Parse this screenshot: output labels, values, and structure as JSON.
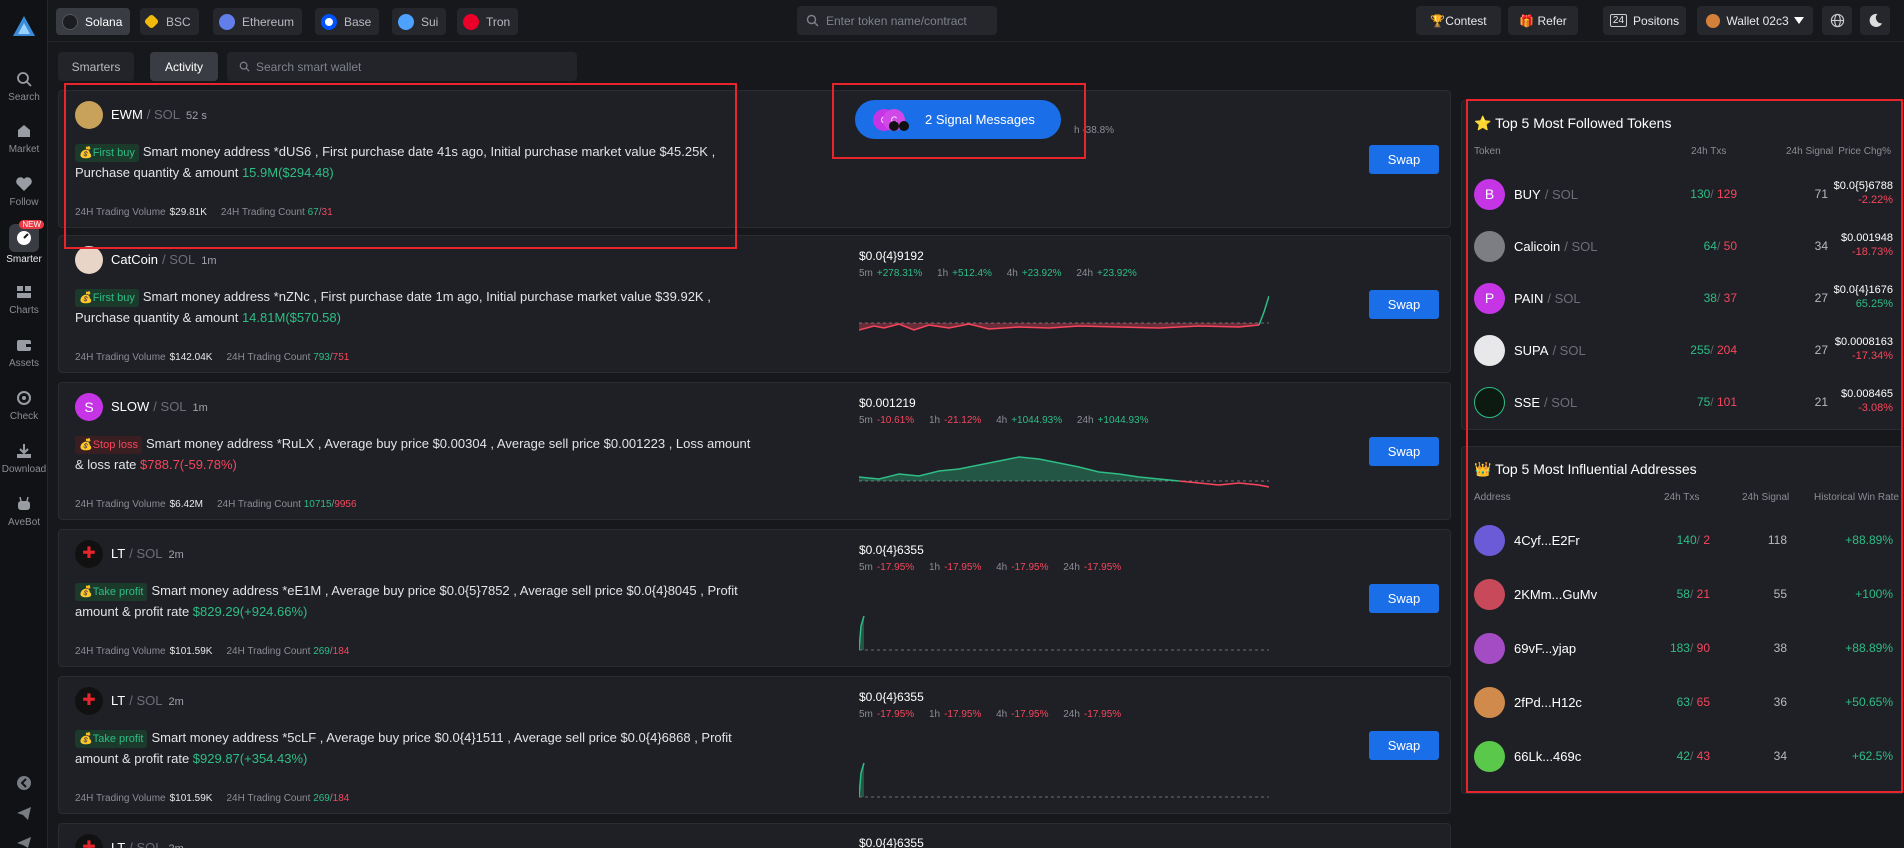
{
  "nav": {
    "items": [
      {
        "label": "Search"
      },
      {
        "label": "Market"
      },
      {
        "label": "Follow"
      },
      {
        "label": "Smarter",
        "badge": "NEW"
      },
      {
        "label": "Charts"
      },
      {
        "label": "Assets"
      },
      {
        "label": "Check"
      },
      {
        "label": "Download"
      },
      {
        "label": "AveBot"
      }
    ]
  },
  "chains": [
    "Solana",
    "BSC",
    "Ethereum",
    "Base",
    "Sui",
    "Tron"
  ],
  "search": {
    "placeholder": "Enter token name/contract"
  },
  "topbar": {
    "contest": "🏆Contest",
    "refer": "🎁 Refer",
    "positions_count": "24",
    "positions_label": "Positons",
    "wallet": "Wallet 02c3"
  },
  "tabs": {
    "smarters": "Smarters",
    "activity": "Activity"
  },
  "wallet_search": {
    "placeholder": "Search smart wallet"
  },
  "signal": {
    "label": "2 Signal Messages",
    "behind_text": "h -38.8%"
  },
  "cards": [
    {
      "symbol": "EWM",
      "chain": "/ SOL",
      "age": "52 s",
      "tag": "First buy",
      "tag_type": "buy",
      "msg": "Smart money address *dUS6 , First purchase date 41s ago, Initial purchase market value $45.25K , Purchase quantity & amount",
      "msg_highlight": "15.9M($294.48)",
      "volume": "$29.81K",
      "count_buy": "67",
      "count_sell": "31",
      "swap": "Swap"
    },
    {
      "symbol": "CatCoin",
      "chain": "/ SOL",
      "age": "1m",
      "tag": "First buy",
      "tag_type": "buy",
      "msg": "Smart money address *nZNc , First purchase date 1m ago, Initial purchase market value $39.92K , Purchase quantity & amount",
      "msg_highlight": "14.81M($570.58)",
      "volume": "$142.04K",
      "count_buy": "793",
      "count_sell": "751",
      "price": "$0.0{4}9192",
      "changes": [
        {
          "p": "5m",
          "v": "+278.31%",
          "up": true
        },
        {
          "p": "1h",
          "v": "+512.4%",
          "up": true
        },
        {
          "p": "4h",
          "v": "+23.92%",
          "up": true
        },
        {
          "p": "24h",
          "v": "+23.92%",
          "up": true
        }
      ],
      "swap": "Swap"
    },
    {
      "symbol": "SLOW",
      "chain": "/ SOL",
      "age": "1m",
      "tag": "Stop loss",
      "tag_type": "loss",
      "msg": "Smart money address *RuLX , Average buy price $0.00304 , Average sell price $0.001223 , Loss amount & loss rate",
      "msg_highlight": "$788.7(-59.78%)",
      "volume": "$6.42M",
      "count_buy": "10715",
      "count_sell": "9956",
      "price": "$0.001219",
      "changes": [
        {
          "p": "5m",
          "v": "-10.61%",
          "up": false
        },
        {
          "p": "1h",
          "v": "-21.12%",
          "up": false
        },
        {
          "p": "4h",
          "v": "+1044.93%",
          "up": true
        },
        {
          "p": "24h",
          "v": "+1044.93%",
          "up": true
        }
      ],
      "swap": "Swap"
    },
    {
      "symbol": "LT",
      "chain": "/ SOL",
      "age": "2m",
      "tag": "Take profit",
      "tag_type": "profit",
      "msg": "Smart money address *eE1M , Average buy price $0.0{5}7852 , Average sell price $0.0{4}8045 , Profit amount & profit rate",
      "msg_highlight": "$829.29(+924.66%)",
      "volume": "$101.59K",
      "count_buy": "269",
      "count_sell": "184",
      "price": "$0.0{4}6355",
      "changes": [
        {
          "p": "5m",
          "v": "-17.95%",
          "up": false
        },
        {
          "p": "1h",
          "v": "-17.95%",
          "up": false
        },
        {
          "p": "4h",
          "v": "-17.95%",
          "up": false
        },
        {
          "p": "24h",
          "v": "-17.95%",
          "up": false
        }
      ],
      "swap": "Swap"
    },
    {
      "symbol": "LT",
      "chain": "/ SOL",
      "age": "2m",
      "tag": "Take profit",
      "tag_type": "profit",
      "msg": "Smart money address *5cLF , Average buy price $0.0{4}1511 , Average sell price $0.0{4}6868 , Profit amount & profit rate",
      "msg_highlight": "$929.87(+354.43%)",
      "volume": "$101.59K",
      "count_buy": "269",
      "count_sell": "184",
      "price": "$0.0{4}6355",
      "changes": [
        {
          "p": "5m",
          "v": "-17.95%",
          "up": false
        },
        {
          "p": "1h",
          "v": "-17.95%",
          "up": false
        },
        {
          "p": "4h",
          "v": "-17.95%",
          "up": false
        },
        {
          "p": "24h",
          "v": "-17.95%",
          "up": false
        }
      ],
      "swap": "Swap"
    },
    {
      "symbol": "LT",
      "chain": "/ SOL",
      "age": "2m",
      "price": "$0.0{4}6355"
    }
  ],
  "labels": {
    "volume": "24H Trading Volume",
    "count": "24H Trading Count"
  },
  "followed": {
    "title": "Top 5 Most Followed Tokens",
    "headers": {
      "token": "Token",
      "txs": "24h Txs",
      "signal": "24h Signal",
      "price": "Price Chg%"
    },
    "rows": [
      {
        "symbol": "BUY",
        "chain": "/ SOL",
        "buys": "130",
        "sells": "129",
        "signal": "71",
        "price": "$0.0{5}6788",
        "chg": "-2.22%",
        "up": false,
        "letter": "B",
        "color": "#c535e6"
      },
      {
        "symbol": "Calicoin",
        "chain": "/ SOL",
        "buys": "64",
        "sells": "50",
        "signal": "34",
        "price": "$0.001948",
        "chg": "-18.73%",
        "up": false,
        "letter": "",
        "color": "#7c7e84"
      },
      {
        "symbol": "PAIN",
        "chain": "/ SOL",
        "buys": "38",
        "sells": "37",
        "signal": "27",
        "price": "$0.0{4}1676",
        "chg": "65.25%",
        "up": true,
        "letter": "P",
        "color": "#c535e6"
      },
      {
        "symbol": "SUPA",
        "chain": "/ SOL",
        "buys": "255",
        "sells": "204",
        "signal": "27",
        "price": "$0.0008163",
        "chg": "-17.34%",
        "up": false,
        "letter": "",
        "color": "#e8e8ea"
      },
      {
        "symbol": "SSE",
        "chain": "/ SOL",
        "buys": "75",
        "sells": "101",
        "signal": "21",
        "price": "$0.008465",
        "chg": "-3.08%",
        "up": false,
        "letter": "",
        "color": "#0d1a12"
      }
    ]
  },
  "influential": {
    "title": "Top 5 Most Influential Addresses",
    "headers": {
      "address": "Address",
      "txs": "24h Txs",
      "signal": "24h Signal",
      "win": "Historical Win Rate"
    },
    "rows": [
      {
        "addr": "4Cyf...E2Fr",
        "buys": "140",
        "sells": "2",
        "signal": "118",
        "win": "+88.89%",
        "color": "#6b5bd6"
      },
      {
        "addr": "2KMm...GuMv",
        "buys": "58",
        "sells": "21",
        "signal": "55",
        "win": "+100%",
        "color": "#c84a5a"
      },
      {
        "addr": "69vF...yjap",
        "buys": "183",
        "sells": "90",
        "signal": "38",
        "win": "+88.89%",
        "color": "#a44cc4"
      },
      {
        "addr": "2fPd...H12c",
        "buys": "63",
        "sells": "65",
        "signal": "36",
        "win": "+50.65%",
        "color": "#d08a4c"
      },
      {
        "addr": "66Lk...469c",
        "buys": "42",
        "sells": "43",
        "signal": "34",
        "win": "+62.5%",
        "color": "#5ac84a"
      }
    ]
  }
}
